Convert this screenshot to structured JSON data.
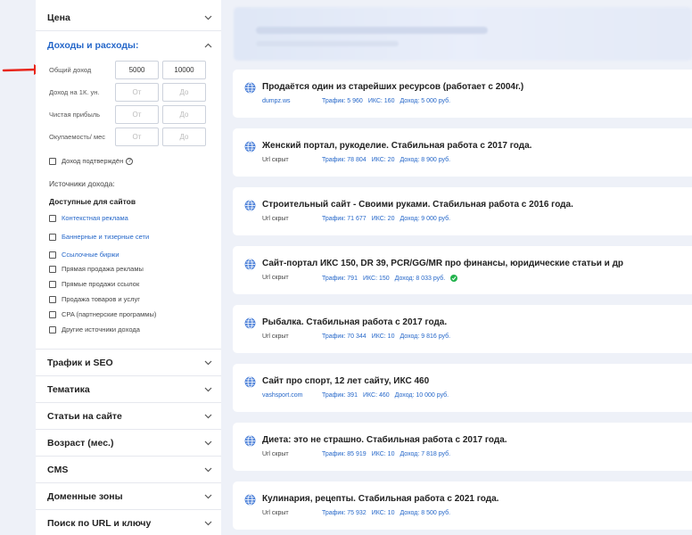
{
  "filters": {
    "sections_top": [
      {
        "label": "Цена"
      }
    ],
    "income": {
      "title": "Доходы и расходы:",
      "rows": [
        {
          "label": "Общий доход",
          "from_value": "5000",
          "to_value": "10000",
          "from_placeholder": "",
          "to_placeholder": ""
        },
        {
          "label": "Доход на 1К. ун.",
          "from_value": "",
          "to_value": "",
          "from_placeholder": "От",
          "to_placeholder": "До"
        },
        {
          "label": "Чистая прибыль",
          "from_value": "",
          "to_value": "",
          "from_placeholder": "От",
          "to_placeholder": "До"
        },
        {
          "label": "Окупаемость/ мес",
          "from_value": "",
          "to_value": "",
          "from_placeholder": "От",
          "to_placeholder": "До"
        }
      ],
      "confirmed_label": "Доход подтверждён",
      "sources_title": "Источники дохода:",
      "available_title": "Доступные для сайтов",
      "sources": [
        {
          "label": "Контекстная реклама"
        },
        {
          "label": "Баннерные и тизерные сети"
        },
        {
          "label": "Ссылочные биржи"
        },
        {
          "label": "Прямая продажа рекламы"
        },
        {
          "label": "Прямые продажи ссылок"
        },
        {
          "label": "Продажа товаров и услуг"
        },
        {
          "label": "CPA (партнерские программы)"
        },
        {
          "label": "Другие источники дохода"
        }
      ]
    },
    "sections_bottom": [
      {
        "label": "Трафик и SEO"
      },
      {
        "label": "Тематика"
      },
      {
        "label": "Статьи на сайте"
      },
      {
        "label": "Возраст (мес.)"
      },
      {
        "label": "CMS"
      },
      {
        "label": "Доменные зоны"
      },
      {
        "label": "Поиск по URL и ключу"
      }
    ]
  },
  "listings": [
    {
      "title": "Продаётся один из старейших ресурсов (работает с 2004г.)",
      "domain": "dumpz.ws",
      "traffic": "Трафик: 5 960",
      "iks": "ИКС: 160",
      "income": "Доход: 5 000 руб."
    },
    {
      "title": "Женский портал, рукоделие. Стабильная работа с 2017 года.",
      "domain": "Url скрыт",
      "traffic": "Трафик: 78 804",
      "iks": "ИКС: 20",
      "income": "Доход: 8 900 руб."
    },
    {
      "title": "Строительный сайт - Своими руками. Стабильная работа с 2016 года.",
      "domain": "Url скрыт",
      "traffic": "Трафик: 71 677",
      "iks": "ИКС: 20",
      "income": "Доход: 9 000 руб."
    },
    {
      "title": "Сайт-портал ИКС 150, DR 39, PCR/GG/MR про финансы, юридические статьи и др",
      "domain": "Url скрыт",
      "traffic": "Трафик: 791",
      "iks": "ИКС: 150",
      "income": "Доход: 8 033 руб."
    },
    {
      "title": "Рыбалка. Стабильная работа с 2017 года.",
      "domain": "Url скрыт",
      "traffic": "Трафик: 70 344",
      "iks": "ИКС: 10",
      "income": "Доход: 9 816 руб."
    },
    {
      "title": "Сайт про спорт, 12 лет сайту, ИКС 460",
      "domain": "vashsport.com",
      "traffic": "Трафик: 391",
      "iks": "ИКС: 460",
      "income": "Доход: 10 000 руб."
    },
    {
      "title": "Диета: это не страшно. Стабильная работа с 2017 года.",
      "domain": "Url скрыт",
      "traffic": "Трафик: 85 919",
      "iks": "ИКС: 10",
      "income": "Доход: 7 818 руб."
    },
    {
      "title": "Кулинария, рецепты. Стабильная работа с 2021 года.",
      "domain": "Url скрыт",
      "traffic": "Трафик: 75 932",
      "iks": "ИКС: 10",
      "income": "Доход: 8 500 руб."
    }
  ],
  "colors": {
    "accent": "#2567c9",
    "arrow": "#e8261c",
    "verified": "#22b24c"
  }
}
